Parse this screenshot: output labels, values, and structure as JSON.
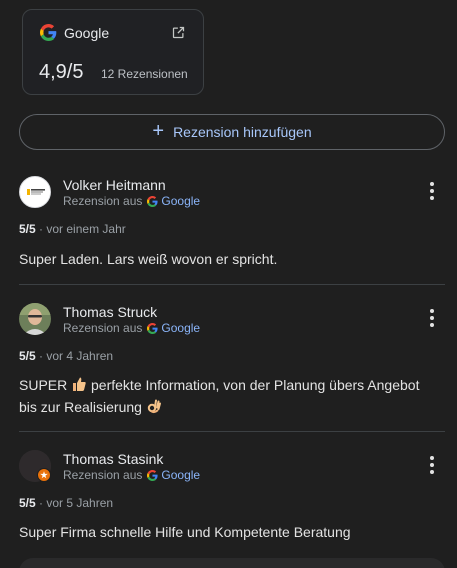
{
  "source": {
    "name": "Google",
    "score": "4,9/5",
    "count": "12 Rezensionen"
  },
  "add_review": {
    "label": "Rezension hinzufügen"
  },
  "reviews": [
    {
      "author": "Volker Heitmann",
      "source_prefix": "Rezension aus",
      "source_name": "Google",
      "rating": "5/5",
      "time": "vor einem Jahr",
      "text": "Super Laden. Lars weiß wovon er spricht."
    },
    {
      "author": "Thomas Struck",
      "source_prefix": "Rezension aus",
      "source_name": "Google",
      "rating": "5/5",
      "time": "vor 4 Jahren",
      "text_part1": "SUPER",
      "text_part2": "perfekte Information, von der Planung übers Angebot bis zur Realisierung"
    },
    {
      "author": "Thomas Stasink",
      "source_prefix": "Rezension aus",
      "source_name": "Google",
      "rating": "5/5",
      "time": "vor 5 Jahren",
      "text": "Super Firma schnelle Hilfe und Kompetente Beratung"
    }
  ],
  "colors": {
    "background": "#1f1f1f",
    "accent": "#a8c7fa",
    "link": "#8ab4f8"
  }
}
